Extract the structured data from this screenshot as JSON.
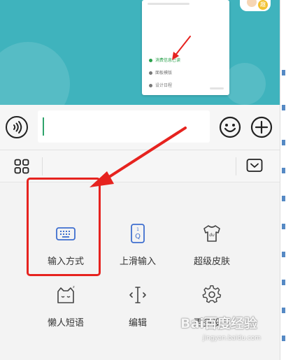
{
  "chat_preview": {
    "rows": [
      "消费信息已读",
      "面板模版",
      "设计日程"
    ]
  },
  "avatar_badge": "趣",
  "input": {
    "value": "",
    "placeholder": ""
  },
  "icons": {
    "voice": "voice-wave-icon",
    "emoji": "emoji-smile-icon",
    "plus": "plus-circle-icon",
    "grid": "grid-apps-icon",
    "collapse": "keyboard-collapse-icon",
    "input_method": "keyboard-icon",
    "swipe_input": "swipe-q-icon",
    "super_skin": "tshirt-skin-icon",
    "lazy_phrases": "lazy-cat-icon",
    "edit": "text-cursor-icon",
    "more_settings": "gear-icon"
  },
  "panel": {
    "items": [
      {
        "label": "输入方式"
      },
      {
        "label": "上滑输入"
      },
      {
        "label": "超级皮肤"
      },
      {
        "label": "懒人短语"
      },
      {
        "label": "编辑"
      },
      {
        "label": "更多设置"
      }
    ]
  },
  "watermark": {
    "brand": "Bai百度经验",
    "url": "jingyan.baidu.com"
  },
  "colors": {
    "chat_bg": "#3fb3bd",
    "highlight": "#e6231f",
    "accent_blue": "#3f6fcf",
    "caret_green": "#2fa36b"
  }
}
